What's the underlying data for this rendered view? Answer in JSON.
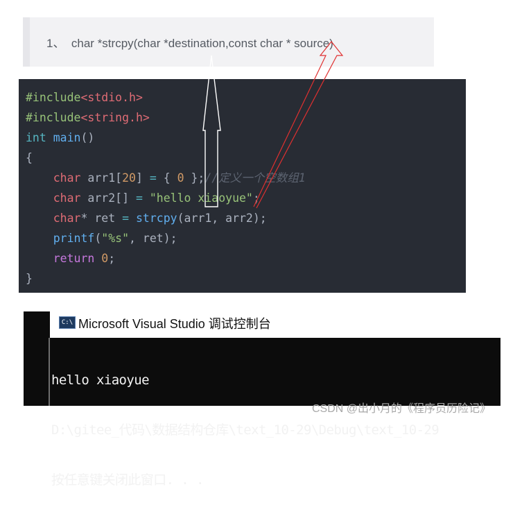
{
  "signature": {
    "text": "1、  char *strcpy(char *destination,const char * source)"
  },
  "code": {
    "lines": [
      [
        {
          "t": "#include",
          "c": "kw-inc"
        },
        {
          "t": "<stdio.h>",
          "c": "inc-file"
        }
      ],
      [
        {
          "t": "#include",
          "c": "kw-inc"
        },
        {
          "t": "<string.h>",
          "c": "inc-file"
        }
      ],
      [
        {
          "t": "int ",
          "c": "kw"
        },
        {
          "t": "main",
          "c": "fn"
        },
        {
          "t": "()",
          "c": "plain"
        }
      ],
      [
        {
          "t": "{",
          "c": "plain"
        }
      ],
      [
        {
          "t": "    ",
          "c": "plain"
        },
        {
          "t": "char",
          "c": "type"
        },
        {
          "t": " arr1[",
          "c": "plain"
        },
        {
          "t": "20",
          "c": "num"
        },
        {
          "t": "] ",
          "c": "plain"
        },
        {
          "t": "=",
          "c": "op"
        },
        {
          "t": " { ",
          "c": "plain"
        },
        {
          "t": "0",
          "c": "num"
        },
        {
          "t": " };",
          "c": "plain"
        },
        {
          "t": "//定义一个空数组1",
          "c": "cmt"
        }
      ],
      [
        {
          "t": "    ",
          "c": "plain"
        },
        {
          "t": "char",
          "c": "type"
        },
        {
          "t": " arr2[] ",
          "c": "plain"
        },
        {
          "t": "=",
          "c": "op"
        },
        {
          "t": " ",
          "c": "plain"
        },
        {
          "t": "\"hello xiaoyue\"",
          "c": "str"
        },
        {
          "t": ";",
          "c": "plain"
        }
      ],
      [
        {
          "t": "    ",
          "c": "plain"
        },
        {
          "t": "char",
          "c": "type"
        },
        {
          "t": "* ret ",
          "c": "plain"
        },
        {
          "t": "=",
          "c": "op"
        },
        {
          "t": " ",
          "c": "plain"
        },
        {
          "t": "strcpy",
          "c": "fn"
        },
        {
          "t": "(arr1, arr2);",
          "c": "plain"
        }
      ],
      [
        {
          "t": "    ",
          "c": "plain"
        },
        {
          "t": "printf",
          "c": "fn"
        },
        {
          "t": "(",
          "c": "plain"
        },
        {
          "t": "\"%s\"",
          "c": "str"
        },
        {
          "t": ", ret);",
          "c": "plain"
        }
      ],
      [
        {
          "t": "    ",
          "c": "plain"
        },
        {
          "t": "return",
          "c": "kw2"
        },
        {
          "t": " ",
          "c": "plain"
        },
        {
          "t": "0",
          "c": "num"
        },
        {
          "t": ";",
          "c": "plain"
        }
      ],
      [
        {
          "t": "}",
          "c": "plain"
        }
      ]
    ]
  },
  "console": {
    "icon_label": "C:\\",
    "title": "Microsoft Visual Studio 调试控制台",
    "lines": [
      "hello xiaoyue",
      "D:\\gitee_代码\\数据结构仓库\\text_10-29\\Debug\\text_10-29",
      "按任意键关闭此窗口. . ."
    ]
  },
  "watermark": "CSDN @出小月的《程序员历险记》",
  "colors": {
    "code_bg": "#282c34",
    "console_bg": "#0c0c0c",
    "annotation_red": "#e03030"
  }
}
